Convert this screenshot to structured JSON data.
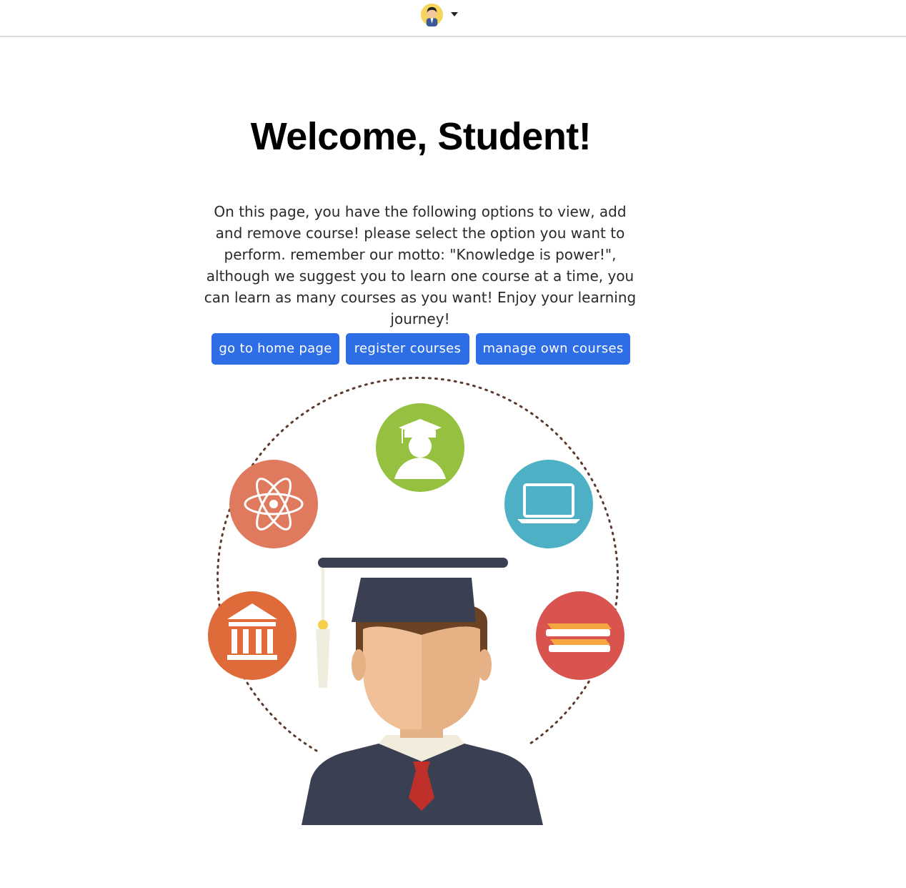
{
  "header": {
    "avatar_icon": "student-avatar-icon",
    "dropdown_icon": "caret-down-icon"
  },
  "main": {
    "title": "Welcome, Student!",
    "intro": "On this page, you have the following options to view, add and remove course! please select the option you want to perform. remember our motto: \"Knowledge is power!\", although we suggest you to learn one course at a time, you can learn as many courses as you want! Enjoy your learning journey!",
    "buttons": {
      "home": "go to home page",
      "register": "register courses",
      "manage": "manage own courses"
    },
    "button_color": "#2d6de6"
  },
  "illustration": {
    "icons": [
      "graduate-icon",
      "laptop-icon",
      "books-icon",
      "atom-icon",
      "museum-icon",
      "graduate-student-icon"
    ],
    "colors": {
      "green": "#96c03f",
      "teal": "#4eb0c4",
      "red": "#d9534f",
      "coral": "#e07a5f",
      "orange": "#e06b3a",
      "navy": "#3b3f52",
      "skin": "#f0c098"
    }
  }
}
